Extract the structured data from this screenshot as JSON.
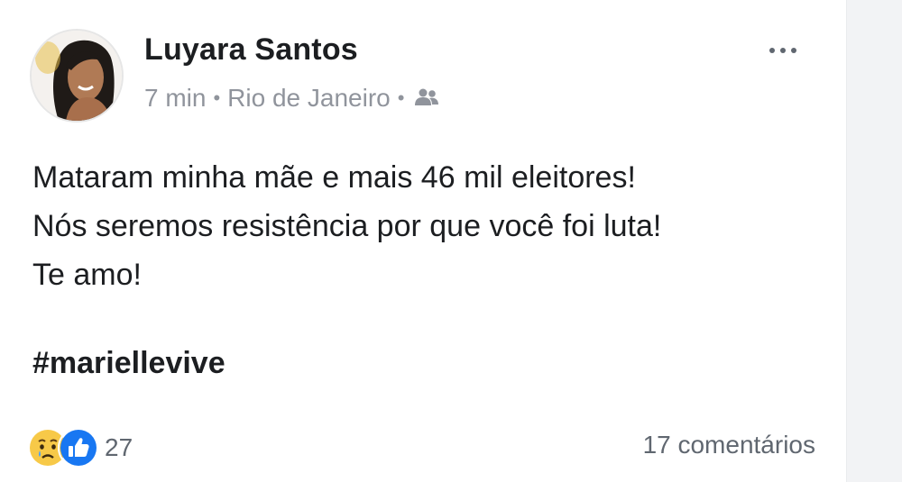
{
  "post": {
    "author": "Luyara Santos",
    "time": "7 min",
    "separator": "•",
    "location": "Rio de Janeiro",
    "audience_icon": "friends-icon",
    "more_icon": "more-options-icon",
    "text_lines": [
      "Mataram minha mãe e mais 46 mil eleitores!",
      "Nós seremos resistência por que você foi luta!",
      "Te amo!"
    ],
    "hashtag": "#mariellevive",
    "reactions": {
      "icons": [
        "sad-reaction-icon",
        "like-reaction-icon"
      ],
      "count": "27"
    },
    "comments_label": "17 comentários"
  },
  "colors": {
    "text_primary": "#1c1e21",
    "text_secondary": "#90949c",
    "like_blue": "#1877f2",
    "sad_yellow": "#f7c948"
  }
}
